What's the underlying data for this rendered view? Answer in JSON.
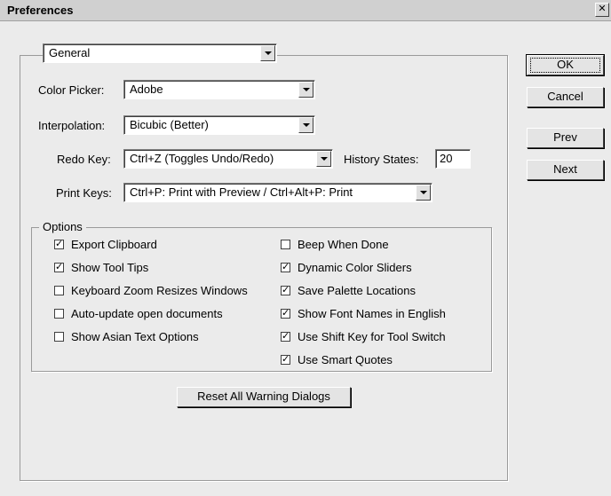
{
  "window": {
    "title": "Preferences",
    "close_glyph": "✕"
  },
  "panel": {
    "selected": "General"
  },
  "fields": {
    "color_picker": {
      "label": "Color Picker:",
      "value": "Adobe"
    },
    "interpolation": {
      "label": "Interpolation:",
      "value": "Bicubic (Better)"
    },
    "redo_key": {
      "label": "Redo Key:",
      "value": "Ctrl+Z (Toggles Undo/Redo)"
    },
    "history_states": {
      "label": "History States:",
      "value": "20"
    },
    "print_keys": {
      "label": "Print Keys:",
      "value": "Ctrl+P: Print with Preview / Ctrl+Alt+P: Print"
    }
  },
  "options": {
    "legend": "Options",
    "left": [
      {
        "label": "Export Clipboard",
        "checked": true
      },
      {
        "label": "Show Tool Tips",
        "checked": true
      },
      {
        "label": "Keyboard Zoom Resizes Windows",
        "checked": false
      },
      {
        "label": "Auto-update open documents",
        "checked": false
      },
      {
        "label": "Show Asian Text Options",
        "checked": false
      }
    ],
    "right": [
      {
        "label": "Beep When Done",
        "checked": false
      },
      {
        "label": "Dynamic Color Sliders",
        "checked": true
      },
      {
        "label": "Save Palette Locations",
        "checked": true
      },
      {
        "label": "Show Font Names in English",
        "checked": true
      },
      {
        "label": "Use Shift Key for Tool Switch",
        "checked": true
      },
      {
        "label": "Use Smart Quotes",
        "checked": true
      }
    ]
  },
  "buttons": {
    "ok": "OK",
    "cancel": "Cancel",
    "prev": "Prev",
    "next": "Next",
    "reset_warnings": "Reset All Warning Dialogs"
  },
  "check_mark": "✓"
}
